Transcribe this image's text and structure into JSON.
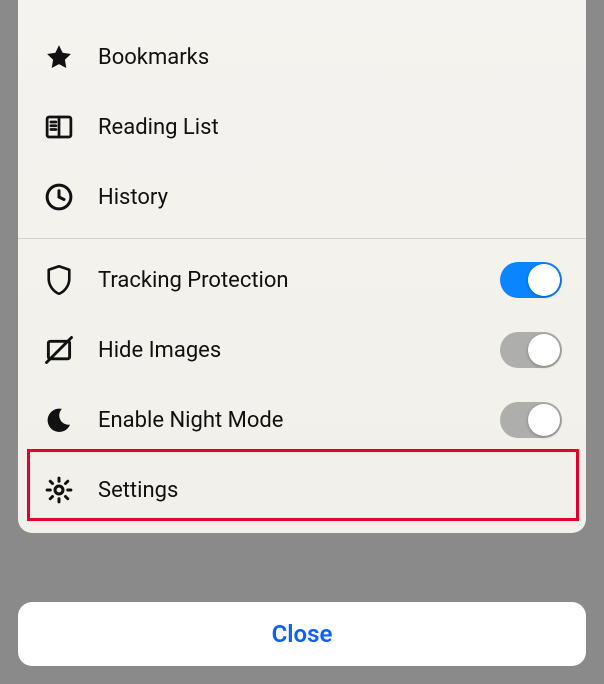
{
  "menu": {
    "bookmarks": {
      "label": "Bookmarks",
      "icon": "star-icon"
    },
    "reading_list": {
      "label": "Reading List",
      "icon": "reading-list-icon"
    },
    "history": {
      "label": "History",
      "icon": "clock-icon"
    },
    "tracking_protection": {
      "label": "Tracking Protection",
      "icon": "shield-icon",
      "enabled": true
    },
    "hide_images": {
      "label": "Hide Images",
      "icon": "hide-images-icon",
      "enabled": false
    },
    "night_mode": {
      "label": "Enable Night Mode",
      "icon": "moon-icon",
      "enabled": false
    },
    "settings": {
      "label": "Settings",
      "icon": "gear-icon"
    }
  },
  "close_label": "Close",
  "colors": {
    "accent": "#0a84ff",
    "close_text": "#0a60ff",
    "highlight_border": "#e3002b",
    "switch_off": "#aeaead"
  },
  "highlighted_item": "settings"
}
